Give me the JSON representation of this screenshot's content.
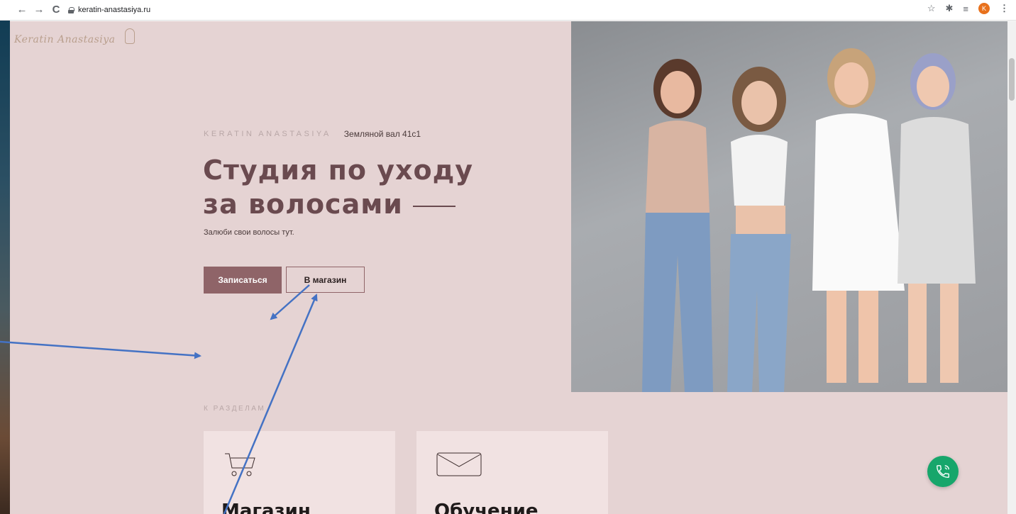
{
  "browser": {
    "back_glyph": "←",
    "forward_glyph": "→",
    "reload_glyph": "C",
    "url": "keratin-anastasiya.ru",
    "bookmark_glyph": "☆",
    "extensions_glyph": "✱",
    "reading_list_glyph": "≡",
    "profile_initial": "K",
    "menu_glyph": "⋮"
  },
  "site": {
    "logo_text": "Keratin Anastasiya",
    "kicker_brand": "KERATIN ANASTASIYA",
    "kicker_address": "Земляной вал 41с1",
    "title_line1": "Студия по уходу",
    "title_line2": "за волосами",
    "subtitle": "Залюби свои волосы тут.",
    "btn_book": "Записаться",
    "btn_shop": "В магазин",
    "sections_label": "К РАЗДЕЛАМ",
    "cards": [
      {
        "title": "Магазин",
        "icon": "shopping-cart-icon"
      },
      {
        "title": "Обучение",
        "icon": "envelope-icon"
      }
    ]
  },
  "colors": {
    "page_bg": "#e5d3d3",
    "accent": "#8f6468",
    "title": "#6a4a4f",
    "call_button": "#17a66b",
    "annotation_arrow": "#4472c4"
  }
}
